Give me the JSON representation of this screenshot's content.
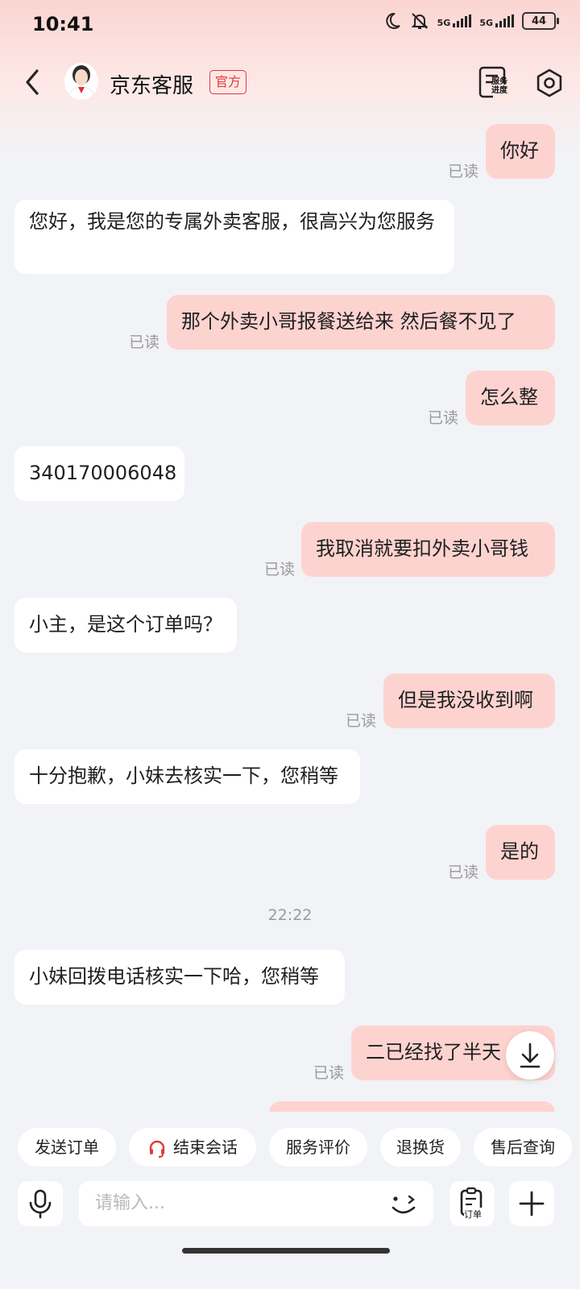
{
  "status_bar": {
    "time": "10:41",
    "network_1": "5G",
    "network_2": "5G",
    "battery": "44"
  },
  "header": {
    "title": "京东客服",
    "badge": "官方",
    "service_progress_label": "服务进度"
  },
  "messages": [
    {
      "side": "out",
      "text": "你好",
      "read": "已读"
    },
    {
      "side": "in",
      "text": "您好，我是您的专属外卖客服，很高兴为您服务"
    },
    {
      "side": "out",
      "text": "那个外卖小哥报餐送给来  然后餐不见了",
      "read": "已读"
    },
    {
      "side": "out",
      "text": "怎么整",
      "read": "已读"
    },
    {
      "side": "in",
      "text": "340170006048"
    },
    {
      "side": "out",
      "text": "我取消就要扣外卖小哥钱",
      "read": "已读"
    },
    {
      "side": "in",
      "text": "小主，是这个订单吗？"
    },
    {
      "side": "out",
      "text": "但是我没收到啊",
      "read": "已读"
    },
    {
      "side": "in",
      "text": "十分抱歉，小妹去核实一下，您稍等"
    },
    {
      "side": "out",
      "text": "是的",
      "read": "已读"
    },
    {
      "side": "in",
      "text": "小妹回拨电话核实一下哈，您稍等"
    },
    {
      "side": "out",
      "text": "二已经找了半天",
      "read": "已读"
    }
  ],
  "timestamp": "22:22",
  "quick_actions": [
    "发送订单",
    "结束会话",
    "服务评价",
    "退换货",
    "售后查询"
  ],
  "input": {
    "placeholder": "请输入...",
    "order_label": "订单"
  },
  "colors": {
    "accent": "#e23a3a",
    "out_bubble": "#fdd3d0",
    "header": "#fbd5d2"
  }
}
